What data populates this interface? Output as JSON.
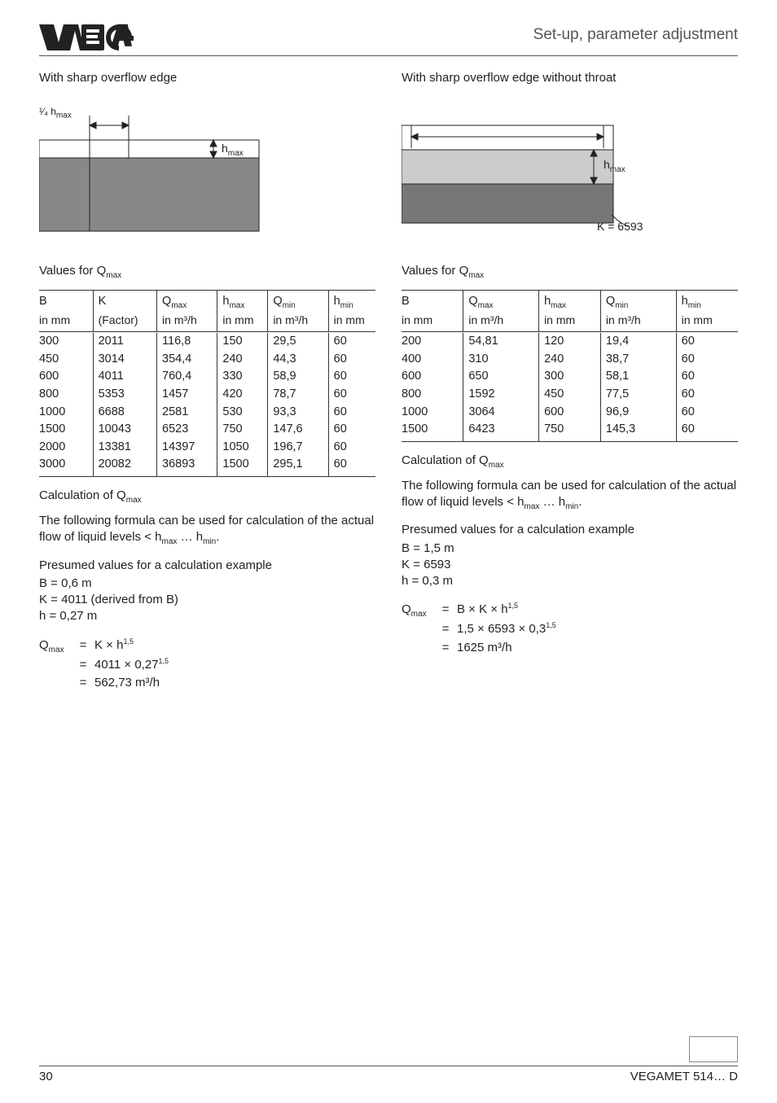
{
  "header": {
    "section_title": "Set-up, parameter adjustment"
  },
  "left": {
    "title": "With sharp overflow edge",
    "diagram": {
      "top_label_prefix": "¹⁄₄ ",
      "top_label_h": "h",
      "top_label_sub": "max",
      "hmax_label_h": "h",
      "hmax_label_sub": "max"
    },
    "values_label_prefix": "Values for Q",
    "values_label_sub": "max",
    "table": {
      "headers": [
        {
          "l1": "B",
          "l2": "in mm"
        },
        {
          "l1": "K",
          "l2": "(Factor)"
        },
        {
          "l1_a": "Q",
          "l1_b": "max",
          "l2": "in m³/h"
        },
        {
          "l1_a": "h",
          "l1_b": "max",
          "l2": "in mm"
        },
        {
          "l1_a": "Q",
          "l1_b": "min",
          "l2": "in m³/h"
        },
        {
          "l1_a": "h",
          "l1_b": "min",
          "l2": "in mm"
        }
      ],
      "rows": [
        [
          "300",
          "2011",
          "116,8",
          "150",
          "29,5",
          "60"
        ],
        [
          "450",
          "3014",
          "354,4",
          "240",
          "44,3",
          "60"
        ],
        [
          "600",
          "4011",
          "760,4",
          "330",
          "58,9",
          "60"
        ],
        [
          "800",
          "5353",
          "1457",
          "420",
          "78,7",
          "60"
        ],
        [
          "1000",
          "6688",
          "2581",
          "530",
          "93,3",
          "60"
        ],
        [
          "1500",
          "10043",
          "6523",
          "750",
          "147,6",
          "60"
        ],
        [
          "2000",
          "13381",
          "14397",
          "1050",
          "196,7",
          "60"
        ],
        [
          "3000",
          "20082",
          "36893",
          "1500",
          "295,1",
          "60"
        ]
      ]
    },
    "calc_title_prefix": "Calculation of Q",
    "calc_title_sub": "max",
    "calc_text_a": "The following formula can be used for calculation of the actual flow of liquid levels < h",
    "calc_text_sub1": "max",
    "calc_text_mid": " … h",
    "calc_text_sub2": "min",
    "calc_text_end": ".",
    "presume_title": "Presumed values for a calculation example",
    "presume_1": "B = 0,6 m",
    "presume_2": "K = 4011 (derived from B)",
    "presume_3": "h = 0,27 m",
    "formula": {
      "lhs_a": "Q",
      "lhs_b": "max",
      "r1": "K  × h",
      "r1_sup": "1,5",
      "r2": "4011 × 0,27",
      "r2_sup": "1,5",
      "r3": "562,73 m³/h"
    }
  },
  "right": {
    "title": "With sharp overflow edge without throat",
    "diagram": {
      "hmax_label_h": "h",
      "hmax_label_sub": "max",
      "k_label": "K = 6593"
    },
    "values_label_prefix": "Values for Q",
    "values_label_sub": "max",
    "table": {
      "headers": [
        {
          "l1": "B",
          "l2": "in mm"
        },
        {
          "l1_a": "Q",
          "l1_b": "max",
          "l2": "in m³/h"
        },
        {
          "l1_a": "h",
          "l1_b": "max",
          "l2": "in mm"
        },
        {
          "l1_a": "Q",
          "l1_b": "min",
          "l2": "in m³/h"
        },
        {
          "l1_a": "h",
          "l1_b": "min",
          "l2": "in mm"
        }
      ],
      "rows": [
        [
          "200",
          "54,81",
          "120",
          "19,4",
          "60"
        ],
        [
          "400",
          "310",
          "240",
          "38,7",
          "60"
        ],
        [
          "600",
          "650",
          "300",
          "58,1",
          "60"
        ],
        [
          "800",
          "1592",
          "450",
          "77,5",
          "60"
        ],
        [
          "1000",
          "3064",
          "600",
          "96,9",
          "60"
        ],
        [
          "1500",
          "6423",
          "750",
          "145,3",
          "60"
        ]
      ]
    },
    "calc_title_prefix": "Calculation of Q",
    "calc_title_sub": "max",
    "calc_text_a": "The following formula can be used for calculation of the actual flow of liquid levels < h",
    "calc_text_sub1": "max",
    "calc_text_mid": " … h",
    "calc_text_sub2": "min",
    "calc_text_end": ".",
    "presume_title": "Presumed values for a calculation example",
    "presume_1": "B = 1,5 m",
    "presume_2": "K = 6593",
    "presume_3": "h = 0,3 m",
    "formula": {
      "lhs_a": "Q",
      "lhs_b": "max",
      "r1": "B × K × h",
      "r1_sup": "1,5",
      "r2": "1,5 × 6593 × 0,3",
      "r2_sup": "1,5",
      "r3": "1625 m³/h"
    }
  },
  "footer": {
    "page_num": "30",
    "right_text": "VEGAMET 514… D"
  },
  "chart_data": [
    {
      "type": "table",
      "title": "Values for Qmax — sharp overflow edge",
      "columns": [
        "B in mm",
        "K (Factor)",
        "Qmax in m3/h",
        "hmax in mm",
        "Qmin in m3/h",
        "hmin in mm"
      ],
      "rows": [
        [
          300,
          2011,
          116.8,
          150,
          29.5,
          60
        ],
        [
          450,
          3014,
          354.4,
          240,
          44.3,
          60
        ],
        [
          600,
          4011,
          760.4,
          330,
          58.9,
          60
        ],
        [
          800,
          5353,
          1457,
          420,
          78.7,
          60
        ],
        [
          1000,
          6688,
          2581,
          530,
          93.3,
          60
        ],
        [
          1500,
          10043,
          6523,
          750,
          147.6,
          60
        ],
        [
          2000,
          13381,
          14397,
          1050,
          196.7,
          60
        ],
        [
          3000,
          20082,
          36893,
          1500,
          295.1,
          60
        ]
      ]
    },
    {
      "type": "table",
      "title": "Values for Qmax — sharp overflow edge without throat",
      "columns": [
        "B in mm",
        "Qmax in m3/h",
        "hmax in mm",
        "Qmin in m3/h",
        "hmin in mm"
      ],
      "rows": [
        [
          200,
          54.81,
          120,
          19.4,
          60
        ],
        [
          400,
          310,
          240,
          38.7,
          60
        ],
        [
          600,
          650,
          300,
          58.1,
          60
        ],
        [
          800,
          1592,
          450,
          77.5,
          60
        ],
        [
          1000,
          3064,
          600,
          96.9,
          60
        ],
        [
          1500,
          6423,
          750,
          145.3,
          60
        ]
      ]
    }
  ]
}
